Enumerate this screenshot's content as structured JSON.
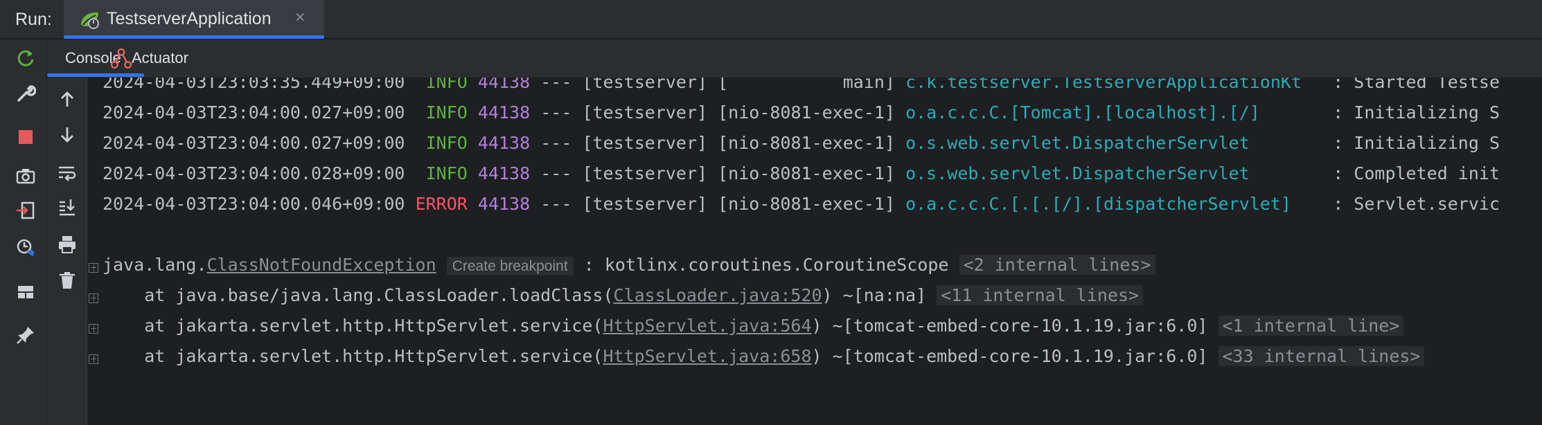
{
  "run_bar": {
    "label": "Run:",
    "tab_title": "TestserverApplication",
    "close_glyph": "×"
  },
  "sub_tabs": [
    {
      "label": "Console",
      "icon": "none"
    },
    {
      "label": "Actuator",
      "icon": "actuator-icon"
    }
  ],
  "left_toolbar": [
    "rerun-icon",
    "wrench-icon",
    "stop-icon",
    "camera-icon",
    "login-icon",
    "coverage-icon",
    "layout-icon",
    "pin-icon"
  ],
  "console_toolbar": [
    "up-arrow-icon",
    "down-arrow-icon",
    "soft-wrap-icon",
    "scroll-to-end-icon",
    "print-icon",
    "trash-icon"
  ],
  "log_lines": [
    {
      "ts": "2024-04-03T23:03:35.449+09:00",
      "level": "INFO",
      "pid": "44138",
      "sep": "---",
      "app": "[testserver]",
      "thread": "[           main]",
      "logger": "c.k.testserver.TestserverApplicationKt",
      "msg": ": Started Testse"
    },
    {
      "ts": "2024-04-03T23:04:00.027+09:00",
      "level": "INFO",
      "pid": "44138",
      "sep": "---",
      "app": "[testserver]",
      "thread": "[nio-8081-exec-1]",
      "logger": "o.a.c.c.C.[Tomcat].[localhost].[/]",
      "msg": ": Initializing S"
    },
    {
      "ts": "2024-04-03T23:04:00.027+09:00",
      "level": "INFO",
      "pid": "44138",
      "sep": "---",
      "app": "[testserver]",
      "thread": "[nio-8081-exec-1]",
      "logger": "o.s.web.servlet.DispatcherServlet",
      "msg": ": Initializing S"
    },
    {
      "ts": "2024-04-03T23:04:00.028+09:00",
      "level": "INFO",
      "pid": "44138",
      "sep": "---",
      "app": "[testserver]",
      "thread": "[nio-8081-exec-1]",
      "logger": "o.s.web.servlet.DispatcherServlet",
      "msg": ": Completed init"
    },
    {
      "ts": "2024-04-03T23:04:00.046+09:00",
      "level": "ERROR",
      "pid": "44138",
      "sep": "---",
      "app": "[testserver]",
      "thread": "[nio-8081-exec-1]",
      "logger": "o.a.c.c.C.[.[.[/].[dispatcherServlet]",
      "msg": ": Servlet.servic"
    }
  ],
  "exception": {
    "prefix": "java.lang.",
    "class_link": "ClassNotFoundException",
    "breakpoint_hint": "Create breakpoint",
    "message": ": kotlinx.coroutines.CoroutineScope",
    "internal": "<2 internal lines>"
  },
  "stack": [
    {
      "pre": "    at java.base/java.lang.ClassLoader.loadClass(",
      "link": "ClassLoader.java:520",
      "post": ") ~[na:na] ",
      "internal": "<11 internal lines>"
    },
    {
      "pre": "    at jakarta.servlet.http.HttpServlet.service(",
      "link": "HttpServlet.java:564",
      "post": ") ~[tomcat-embed-core-10.1.19.jar:6.0] ",
      "internal": "<1 internal line>"
    },
    {
      "pre": "    at jakarta.servlet.http.HttpServlet.service(",
      "link": "HttpServlet.java:658",
      "post": ") ~[tomcat-embed-core-10.1.19.jar:6.0] ",
      "internal": "<33 internal lines>"
    }
  ],
  "colors": {
    "background": "#1e1f22",
    "panel": "#2b2d30",
    "accent": "#3574f0",
    "info": "#5fb040",
    "error": "#f75464",
    "pid": "#b37fda",
    "logger": "#2aacb8"
  }
}
